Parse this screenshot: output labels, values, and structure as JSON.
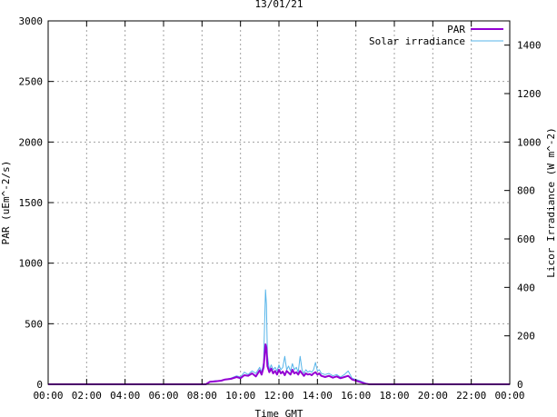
{
  "chart_data": {
    "type": "line",
    "title": "13/01/21",
    "xlabel": "Time GMT",
    "ylabel": "PAR (uEm^-2/s)",
    "y2label": "Licor Irradiance (W m^-2)",
    "x_ticks": [
      "00:00",
      "02:00",
      "04:00",
      "06:00",
      "08:00",
      "10:00",
      "12:00",
      "14:00",
      "16:00",
      "18:00",
      "20:00",
      "22:00",
      "00:00"
    ],
    "x_range_hours": [
      0,
      24
    ],
    "ylim": [
      0,
      3000
    ],
    "y_ticks": [
      0,
      500,
      1000,
      1500,
      2000,
      2500,
      3000
    ],
    "y2lim": [
      0,
      1500
    ],
    "y2_ticks": [
      0,
      200,
      400,
      600,
      800,
      1000,
      1200,
      1400
    ],
    "grid": true,
    "legend_position": "top-right",
    "series": [
      {
        "name": "PAR",
        "axis": "y",
        "color": "#9400d3",
        "points": [
          [
            0.0,
            0
          ],
          [
            8.2,
            0
          ],
          [
            8.4,
            20
          ],
          [
            8.7,
            25
          ],
          [
            9.0,
            30
          ],
          [
            9.2,
            40
          ],
          [
            9.5,
            45
          ],
          [
            9.8,
            60
          ],
          [
            10.0,
            50
          ],
          [
            10.2,
            75
          ],
          [
            10.4,
            70
          ],
          [
            10.6,
            90
          ],
          [
            10.8,
            65
          ],
          [
            11.0,
            115
          ],
          [
            11.1,
            80
          ],
          [
            11.2,
            140
          ],
          [
            11.3,
            330
          ],
          [
            11.35,
            300
          ],
          [
            11.4,
            150
          ],
          [
            11.5,
            100
          ],
          [
            11.6,
            130
          ],
          [
            11.7,
            90
          ],
          [
            11.8,
            110
          ],
          [
            11.9,
            80
          ],
          [
            12.0,
            120
          ],
          [
            12.1,
            90
          ],
          [
            12.2,
            105
          ],
          [
            12.3,
            75
          ],
          [
            12.4,
            110
          ],
          [
            12.5,
            95
          ],
          [
            12.6,
            80
          ],
          [
            12.7,
            120
          ],
          [
            12.8,
            90
          ],
          [
            12.9,
            100
          ],
          [
            13.0,
            80
          ],
          [
            13.1,
            110
          ],
          [
            13.2,
            90
          ],
          [
            13.3,
            70
          ],
          [
            13.4,
            90
          ],
          [
            13.5,
            80
          ],
          [
            13.6,
            85
          ],
          [
            13.7,
            75
          ],
          [
            13.8,
            90
          ],
          [
            13.9,
            100
          ],
          [
            14.0,
            80
          ],
          [
            14.1,
            90
          ],
          [
            14.2,
            70
          ],
          [
            14.4,
            60
          ],
          [
            14.6,
            70
          ],
          [
            14.8,
            55
          ],
          [
            15.0,
            65
          ],
          [
            15.2,
            50
          ],
          [
            15.4,
            60
          ],
          [
            15.6,
            70
          ],
          [
            15.8,
            40
          ],
          [
            16.0,
            30
          ],
          [
            16.2,
            20
          ],
          [
            16.5,
            5
          ],
          [
            16.7,
            0
          ],
          [
            24.0,
            0
          ]
        ]
      },
      {
        "name": "Solar irradiance",
        "axis": "y2",
        "color": "#56b4e9",
        "points": [
          [
            0.0,
            0
          ],
          [
            8.2,
            0
          ],
          [
            8.4,
            10
          ],
          [
            8.7,
            15
          ],
          [
            9.0,
            15
          ],
          [
            9.2,
            20
          ],
          [
            9.5,
            25
          ],
          [
            9.8,
            35
          ],
          [
            10.0,
            30
          ],
          [
            10.2,
            50
          ],
          [
            10.4,
            40
          ],
          [
            10.6,
            55
          ],
          [
            10.8,
            45
          ],
          [
            11.0,
            70
          ],
          [
            11.1,
            50
          ],
          [
            11.2,
            90
          ],
          [
            11.3,
            390
          ],
          [
            11.35,
            330
          ],
          [
            11.4,
            120
          ],
          [
            11.5,
            60
          ],
          [
            11.6,
            80
          ],
          [
            11.7,
            60
          ],
          [
            11.8,
            70
          ],
          [
            11.9,
            55
          ],
          [
            12.0,
            80
          ],
          [
            12.1,
            60
          ],
          [
            12.2,
            70
          ],
          [
            12.3,
            115
          ],
          [
            12.4,
            60
          ],
          [
            12.5,
            75
          ],
          [
            12.6,
            55
          ],
          [
            12.7,
            85
          ],
          [
            12.8,
            60
          ],
          [
            12.9,
            70
          ],
          [
            13.0,
            50
          ],
          [
            13.1,
            115
          ],
          [
            13.2,
            60
          ],
          [
            13.3,
            45
          ],
          [
            13.4,
            60
          ],
          [
            13.5,
            50
          ],
          [
            13.6,
            55
          ],
          [
            13.7,
            50
          ],
          [
            13.8,
            60
          ],
          [
            13.9,
            90
          ],
          [
            14.0,
            55
          ],
          [
            14.1,
            60
          ],
          [
            14.2,
            45
          ],
          [
            14.4,
            40
          ],
          [
            14.6,
            45
          ],
          [
            14.8,
            35
          ],
          [
            15.0,
            40
          ],
          [
            15.2,
            30
          ],
          [
            15.4,
            40
          ],
          [
            15.6,
            55
          ],
          [
            15.8,
            25
          ],
          [
            16.0,
            20
          ],
          [
            16.2,
            15
          ],
          [
            16.5,
            5
          ],
          [
            16.7,
            0
          ],
          [
            24.0,
            0
          ]
        ]
      }
    ]
  }
}
